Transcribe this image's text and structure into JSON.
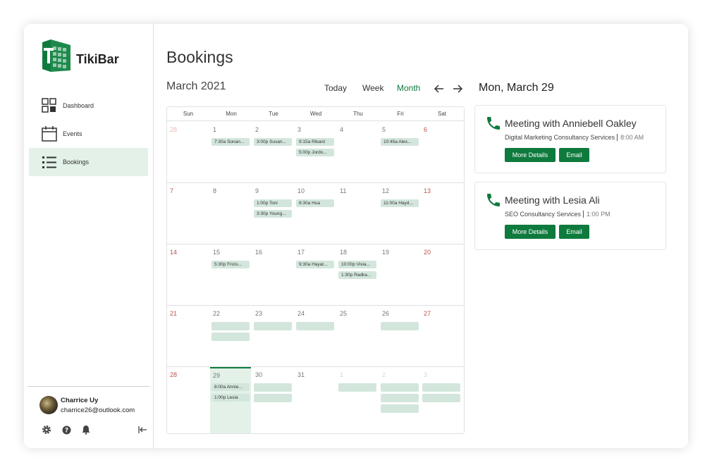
{
  "app": {
    "name": "TikiBar"
  },
  "sidebar": {
    "items": [
      {
        "label": "Dashboard"
      },
      {
        "label": "Events"
      },
      {
        "label": "Bookings"
      }
    ],
    "user": {
      "name": "Charrice Uy",
      "email": "charrice26@outlook.com"
    }
  },
  "page": {
    "title": "Bookings"
  },
  "calendar": {
    "month_label": "March 2021",
    "views": {
      "today": "Today",
      "week": "Week",
      "month": "Month",
      "active": "Month"
    },
    "weekdays": [
      "Sun",
      "Mon",
      "Tue",
      "Wed",
      "Thu",
      "Fri",
      "Sat"
    ],
    "weeks": [
      {
        "days": [
          {
            "n": "28",
            "style": "faded",
            "events": []
          },
          {
            "n": "1",
            "events": [
              "7:30a Sonan..."
            ]
          },
          {
            "n": "2",
            "events": [
              "3:00p Susan..."
            ]
          },
          {
            "n": "3",
            "events": [
              "9:15a Rikard",
              "5:00p Jordo..."
            ]
          },
          {
            "n": "4",
            "events": []
          },
          {
            "n": "5",
            "events": [
              "10:45a Alex..."
            ]
          },
          {
            "n": "6",
            "style": "red",
            "events": []
          }
        ]
      },
      {
        "days": [
          {
            "n": "7",
            "style": "red",
            "events": []
          },
          {
            "n": "8",
            "events": []
          },
          {
            "n": "9",
            "events": [
              "1:00p Toni",
              "3:30p Young..."
            ]
          },
          {
            "n": "10",
            "events": [
              "8:30a Hua"
            ]
          },
          {
            "n": "11",
            "events": []
          },
          {
            "n": "12",
            "events": [
              "11:00a Hayd..."
            ]
          },
          {
            "n": "13",
            "style": "red",
            "events": []
          }
        ]
      },
      {
        "days": [
          {
            "n": "14",
            "style": "red",
            "events": []
          },
          {
            "n": "15",
            "events": [
              "5:30p Fricis..."
            ]
          },
          {
            "n": "16",
            "events": []
          },
          {
            "n": "17",
            "events": [
              "9:30a Hayat..."
            ]
          },
          {
            "n": "18",
            "events": [
              "10:00p Vivia...",
              "1:30p Radka..."
            ]
          },
          {
            "n": "19",
            "events": []
          },
          {
            "n": "20",
            "style": "red",
            "events": []
          }
        ]
      },
      {
        "days": [
          {
            "n": "21",
            "style": "red",
            "events": []
          },
          {
            "n": "22",
            "events": [
              "",
              ""
            ]
          },
          {
            "n": "23",
            "events": [
              ""
            ]
          },
          {
            "n": "24",
            "events": [
              ""
            ]
          },
          {
            "n": "25",
            "events": []
          },
          {
            "n": "26",
            "events": [
              ""
            ]
          },
          {
            "n": "27",
            "style": "red",
            "events": []
          }
        ]
      },
      {
        "days": [
          {
            "n": "28",
            "style": "red",
            "events": []
          },
          {
            "n": "29",
            "today": true,
            "events": [
              "8:00a Annie...",
              "1:00p Lesia"
            ]
          },
          {
            "n": "30",
            "events": [
              "",
              ""
            ]
          },
          {
            "n": "31",
            "events": []
          },
          {
            "n": "1",
            "style": "dim",
            "events": [
              ""
            ]
          },
          {
            "n": "2",
            "style": "dim",
            "events": [
              "",
              "",
              ""
            ]
          },
          {
            "n": "3",
            "style": "dim",
            "events": [
              "",
              ""
            ]
          }
        ]
      }
    ]
  },
  "detail": {
    "date": "Mon, March 29",
    "meetings": [
      {
        "title": "Meeting with Anniebell Oakley",
        "service": "Digital Marketing Consultancy Services",
        "time": "8:00 AM",
        "details_label": "More Details",
        "email_label": "Email"
      },
      {
        "title": "Meeting with Lesia Ali",
        "service": "SEO Consultancy Services",
        "time": "1:00 PM",
        "details_label": "More Details",
        "email_label": "Email"
      }
    ]
  },
  "colors": {
    "accent": "#0f7a3d",
    "event_bg": "#d3e6dc",
    "active_nav": "#e3f1e8",
    "weekend": "#c0504d"
  }
}
